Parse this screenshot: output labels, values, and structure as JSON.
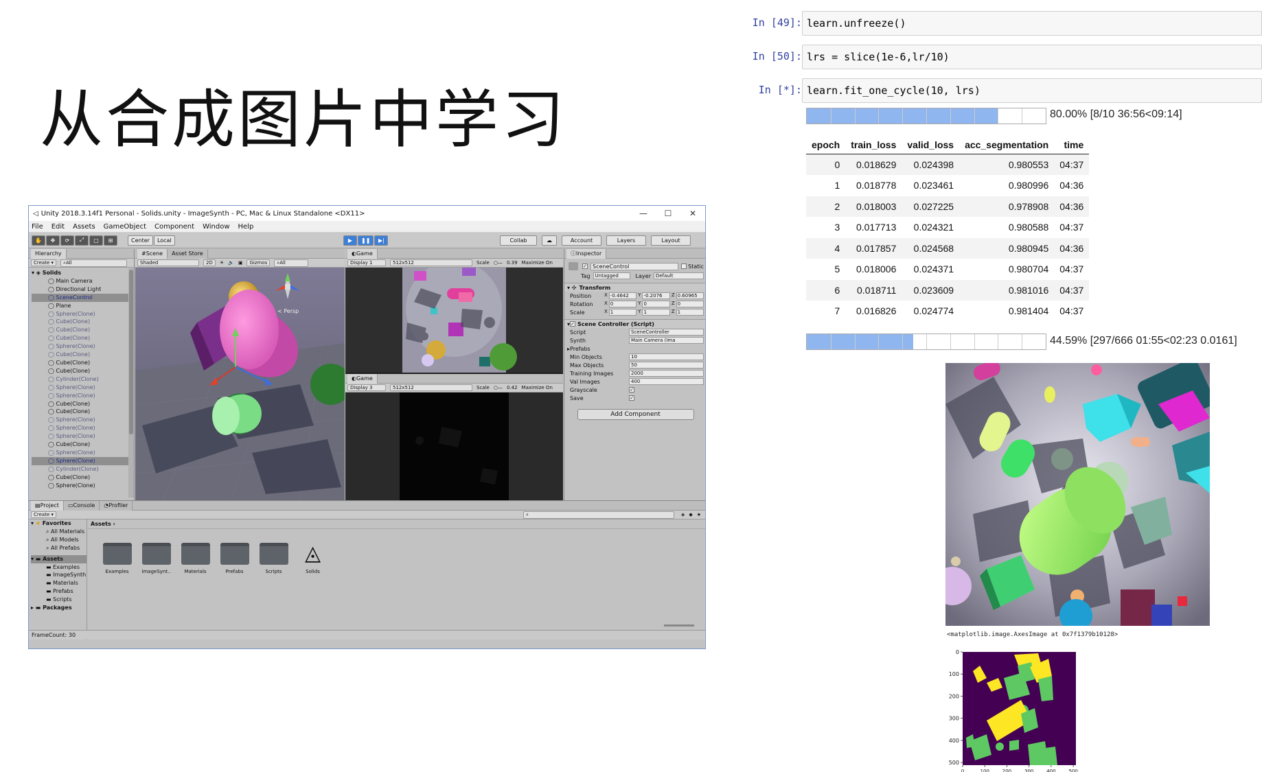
{
  "slide": {
    "title": "从合成图片中学习"
  },
  "unity": {
    "window_title": "Unity 2018.3.14f1 Personal - Solids.unity - ImageSynth - PC, Mac & Linux Standalone <DX11>",
    "menu": [
      "File",
      "Edit",
      "Assets",
      "GameObject",
      "Component",
      "Window",
      "Help"
    ],
    "toolbar": {
      "center": "Center",
      "local": "Local",
      "collab": "Collab",
      "account": "Account",
      "layers": "Layers",
      "layout": "Layout"
    },
    "hierarchy": {
      "tab": "Hierarchy",
      "create": "Create",
      "search": "All",
      "root": "Solids",
      "items": [
        {
          "label": "Main Camera",
          "style": "plain"
        },
        {
          "label": "Directional Light",
          "style": "plain"
        },
        {
          "label": "SceneControl",
          "style": "sel"
        },
        {
          "label": "Plane",
          "style": "plain"
        },
        {
          "label": "Sphere(Clone)",
          "style": "grey"
        },
        {
          "label": "Cube(Clone)",
          "style": "grey"
        },
        {
          "label": "Cube(Clone)",
          "style": "grey"
        },
        {
          "label": "Cube(Clone)",
          "style": "grey"
        },
        {
          "label": "Sphere(Clone)",
          "style": "grey"
        },
        {
          "label": "Cube(Clone)",
          "style": "grey"
        },
        {
          "label": "Cube(Clone)",
          "style": "plain"
        },
        {
          "label": "Cube(Clone)",
          "style": "plain"
        },
        {
          "label": "Cylinder(Clone)",
          "style": "grey"
        },
        {
          "label": "Sphere(Clone)",
          "style": "grey"
        },
        {
          "label": "Sphere(Clone)",
          "style": "grey"
        },
        {
          "label": "Cube(Clone)",
          "style": "plain"
        },
        {
          "label": "Cube(Clone)",
          "style": "plain"
        },
        {
          "label": "Sphere(Clone)",
          "style": "grey"
        },
        {
          "label": "Sphere(Clone)",
          "style": "grey"
        },
        {
          "label": "Sphere(Clone)",
          "style": "grey"
        },
        {
          "label": "Cube(Clone)",
          "style": "plain"
        },
        {
          "label": "Sphere(Clone)",
          "style": "grey"
        },
        {
          "label": "Sphere(Clone)",
          "style": "sel"
        },
        {
          "label": "Cylinder(Clone)",
          "style": "grey"
        },
        {
          "label": "Cube(Clone)",
          "style": "plain"
        },
        {
          "label": "Sphere(Clone)",
          "style": "plain"
        }
      ]
    },
    "scene": {
      "tab_scene": "Scene",
      "tab_store": "Asset Store",
      "shaded": "Shaded",
      "twod": "2D",
      "gizmos": "Gizmos",
      "search": "All",
      "persp": "< Persp"
    },
    "game1": {
      "tab": "Game",
      "display": "Display 1",
      "res": "512x512",
      "scale_label": "Scale",
      "scale": "0.39",
      "maximize": "Maximize On"
    },
    "game2": {
      "tab": "Game",
      "display": "Display 3",
      "res": "512x512",
      "scale_label": "Scale",
      "scale": "0.42",
      "maximize": "Maximize On"
    },
    "inspector": {
      "tab": "Inspector",
      "object_name": "SceneControl",
      "static": "Static",
      "tag_label": "Tag",
      "tag": "Untagged",
      "layer_label": "Layer",
      "layer": "Default",
      "transform": "Transform",
      "position_label": "Position",
      "position": [
        "-0.4642",
        "-0.2076",
        "0.60965"
      ],
      "rotation_label": "Rotation",
      "rotation": [
        "0",
        "0",
        "0"
      ],
      "scale_label": "Scale",
      "scale": [
        "1",
        "1",
        "1"
      ],
      "script_header": "Scene Controller (Script)",
      "fields": [
        {
          "label": "Script",
          "value": "SceneController"
        },
        {
          "label": "Synth",
          "value": "Main Camera (Ima"
        },
        {
          "label": "Prefabs",
          "value": ""
        },
        {
          "label": "Min Objects",
          "value": "10"
        },
        {
          "label": "Max Objects",
          "value": "50"
        },
        {
          "label": "Training Images",
          "value": "2000"
        },
        {
          "label": "Val Images",
          "value": "400"
        },
        {
          "label": "Grayscale",
          "value": "✓"
        },
        {
          "label": "Save",
          "value": "✓"
        }
      ],
      "add_component": "Add Component"
    },
    "project": {
      "tab_project": "Project",
      "tab_console": "Console",
      "tab_profiler": "Profiler",
      "create": "Create",
      "favorites": "Favorites",
      "fav_items": [
        "All Materials",
        "All Models",
        "All Prefabs"
      ],
      "assets": "Assets",
      "asset_items": [
        "Examples",
        "ImageSynth",
        "Materials",
        "Prefabs",
        "Scripts"
      ],
      "packages": "Packages",
      "breadcrumb": "Assets",
      "folders": [
        "Examples",
        "ImageSynt..",
        "Materials",
        "Prefabs",
        "Scripts",
        "Solids"
      ]
    },
    "status": "FrameCount: 30"
  },
  "notebook": {
    "cells": [
      {
        "prompt": "In  [49]:",
        "code": "learn.unfreeze()"
      },
      {
        "prompt": "In  [50]:",
        "code": "lrs = slice(1e-6,lr/10)"
      },
      {
        "prompt": "In  [*]:",
        "code": "learn.fit_one_cycle(10, lrs)"
      }
    ],
    "progress1": {
      "fraction": 0.8,
      "text": "80.00% [8/10 36:56<09:14]"
    },
    "progress2": {
      "fraction": 0.4459,
      "text": "44.59% [297/666 01:55<02:23 0.0161]"
    },
    "table": {
      "columns": [
        "epoch",
        "train_loss",
        "valid_loss",
        "acc_segmentation",
        "time"
      ],
      "rows": [
        [
          "0",
          "0.018629",
          "0.024398",
          "0.980553",
          "04:37"
        ],
        [
          "1",
          "0.018778",
          "0.023461",
          "0.980996",
          "04:36"
        ],
        [
          "2",
          "0.018003",
          "0.027225",
          "0.978908",
          "04:36"
        ],
        [
          "3",
          "0.017713",
          "0.024321",
          "0.980588",
          "04:37"
        ],
        [
          "4",
          "0.017857",
          "0.024568",
          "0.980945",
          "04:36"
        ],
        [
          "5",
          "0.018006",
          "0.024371",
          "0.980704",
          "04:37"
        ],
        [
          "6",
          "0.018711",
          "0.023609",
          "0.981016",
          "04:37"
        ],
        [
          "7",
          "0.016826",
          "0.024774",
          "0.981404",
          "04:37"
        ]
      ]
    },
    "axes_output": "<matplotlib.image.AxesImage at 0x7f1379b10128>",
    "seg_plot": {
      "xticks": [
        "0",
        "100",
        "200",
        "300",
        "400",
        "500"
      ],
      "yticks": [
        "0",
        "100",
        "200",
        "300",
        "400",
        "500"
      ],
      "colors": {
        "background": "#440154",
        "yellow": "#fde725",
        "green": "#5ec962"
      }
    }
  }
}
